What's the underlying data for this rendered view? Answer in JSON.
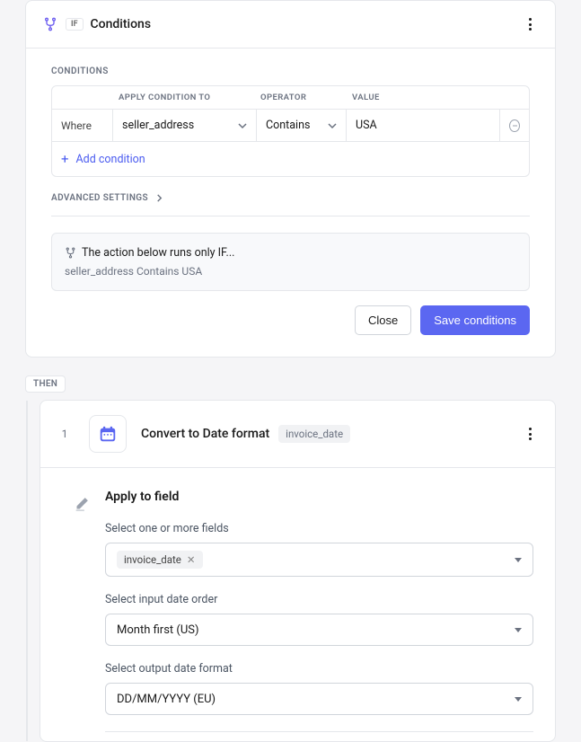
{
  "conditions_card": {
    "if_badge": "IF",
    "title": "Conditions",
    "section_label": "CONDITIONS",
    "columns": {
      "apply": "APPLY CONDITION TO",
      "operator": "OPERATOR",
      "value": "VALUE"
    },
    "row": {
      "where": "Where",
      "field": "seller_address",
      "operator": "Contains",
      "value": "USA"
    },
    "add_condition": "Add condition",
    "advanced_label": "ADVANCED SETTINGS",
    "summary_heading": "The action below runs only IF...",
    "summary_text": "seller_address Contains USA",
    "close": "Close",
    "save": "Save conditions"
  },
  "then_label": "THEN",
  "step": {
    "index": "1",
    "title": "Convert to Date format",
    "pill": "invoice_date",
    "form": {
      "heading": "Apply to field",
      "fields_label": "Select one or more fields",
      "token": "invoice_date",
      "input_order_label": "Select input date order",
      "input_order_value": "Month first (US)",
      "output_format_label": "Select output date format",
      "output_format_value": "DD/MM/YYYY (EU)"
    }
  }
}
